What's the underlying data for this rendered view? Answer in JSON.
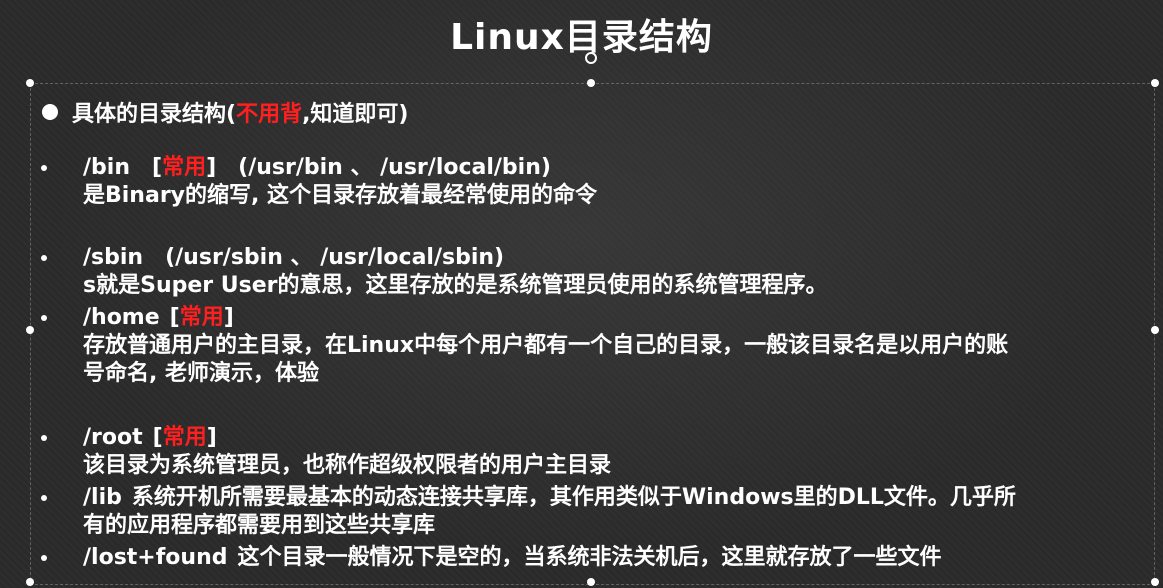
{
  "title": "Linux目录结构",
  "heading": {
    "prefix": "具体的目录结构(",
    "highlight": "不用背",
    "suffix": ",知道即可)"
  },
  "items": [
    {
      "path": "/bin",
      "tag_open": "[",
      "tag": "常用",
      "tag_close": "]",
      "extra": "(/usr/bin 、 /usr/local/bin)",
      "desc": "是Binary的缩写, 这个目录存放着最经常使用的命令"
    },
    {
      "path": "/sbin",
      "extra": "(/usr/sbin 、 /usr/local/sbin)",
      "desc": "s就是Super User的意思，这里存放的是系统管理员使用的系统管理程序。"
    },
    {
      "path": "/home",
      "tag_open": "[",
      "tag": "常用",
      "tag_close": "]",
      "desc": "存放普通用户的主目录，在Linux中每个用户都有一个自己的目录，一般该目录名是以用户的账",
      "desc2": "号命名, 老师演示，体验"
    },
    {
      "path": "/root",
      "tag_open": "[",
      "tag": "常用",
      "tag_close": "]",
      "desc": "该目录为系统管理员，也称作超级权限者的用户主目录"
    },
    {
      "path": "/lib",
      "desc": "系统开机所需要最基本的动态连接共享库，其作用类似于Windows里的DLL文件。几乎所",
      "desc2": "有的应用程序都需要用到这些共享库"
    },
    {
      "path": "/lost+found",
      "desc": "这个目录一般情况下是空的，当系统非法关机后，这里就存放了一些文件"
    }
  ],
  "colors": {
    "background": "#2b2b2b",
    "text": "#ffffff",
    "highlight": "#ff1f1f"
  }
}
